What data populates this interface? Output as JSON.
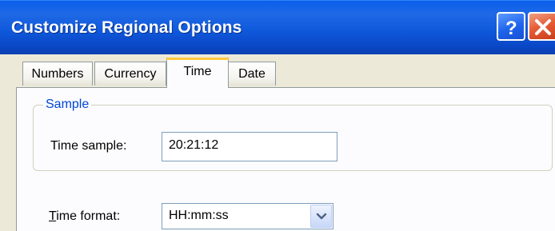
{
  "window": {
    "title": "Customize Regional Options",
    "help_icon": "help-icon",
    "close_icon": "close-icon"
  },
  "tabs": [
    {
      "label": "Numbers",
      "active": false
    },
    {
      "label": "Currency",
      "active": false
    },
    {
      "label": "Time",
      "active": true
    },
    {
      "label": "Date",
      "active": false
    }
  ],
  "sample_group": {
    "label": "Sample",
    "time_sample_label": "Time sample:",
    "time_sample_value": "20:21:12"
  },
  "time_format": {
    "label_mnemonic": "T",
    "label_rest": "ime format:",
    "value": "HH:mm:ss",
    "dropdown_icon": "chevron-down-icon"
  },
  "colors": {
    "titlebar": "#0A5FEB",
    "group_label": "#0046D5",
    "close_button": "#E65B35",
    "active_tab_accent": "#FFC83C"
  }
}
